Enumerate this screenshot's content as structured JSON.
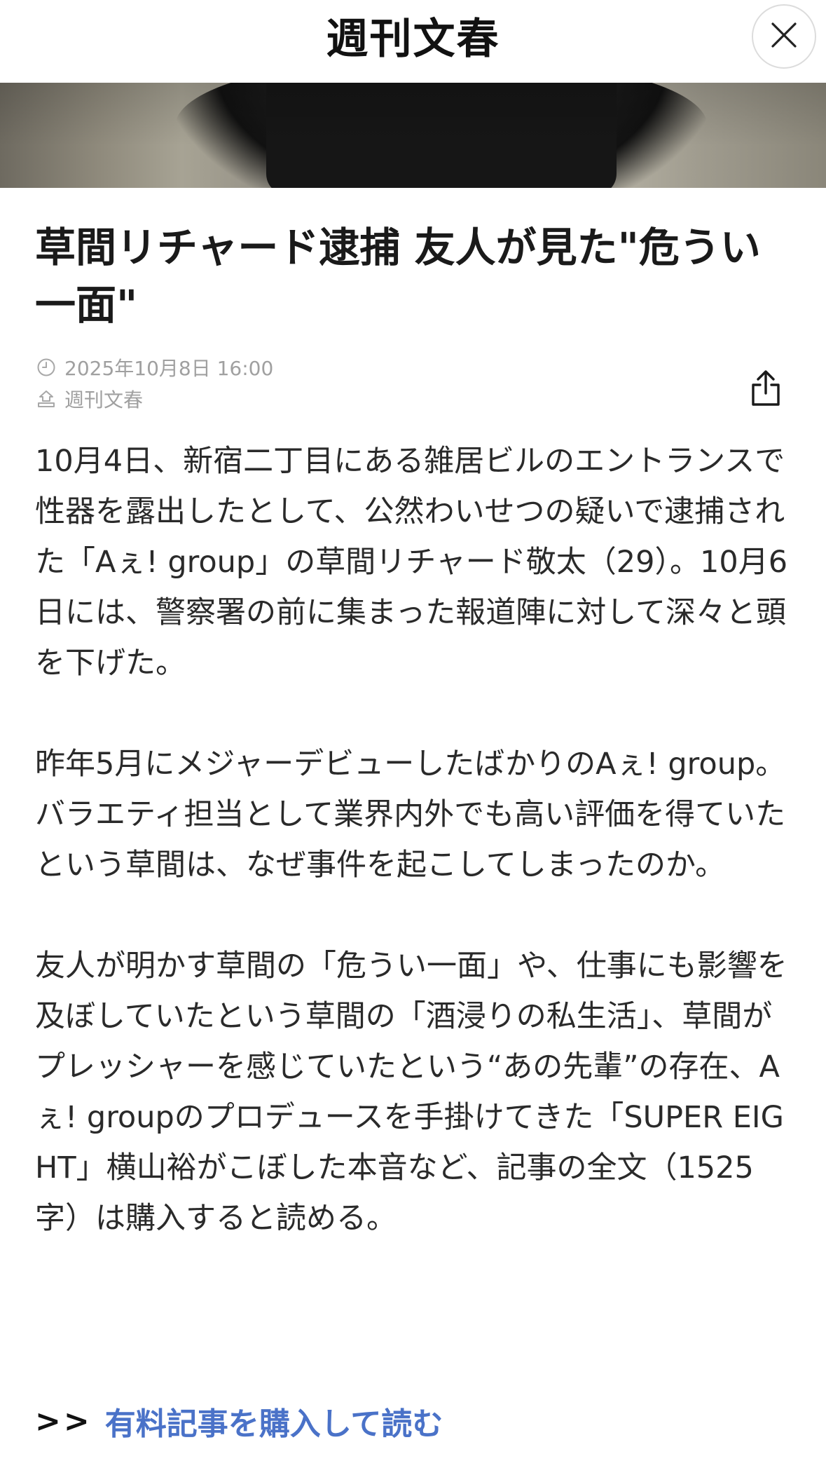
{
  "header": {
    "brand": "週刊文春",
    "close_icon": "close-icon"
  },
  "hero": {
    "description": "article-photo"
  },
  "article": {
    "title": "草間リチャード逮捕 友人が見た\"危うい一面\"",
    "date": "2025年10月8日 16:00",
    "source": "週刊文春",
    "date_icon": "clock-icon",
    "source_icon": "publisher-icon",
    "share_icon": "share-icon",
    "paragraphs": [
      "10月4日、新宿二丁目にある雑居ビルのエントランスで性器を露出したとして、公然わいせつの疑いで逮捕された「Aぇ! group」の草間リチャード敬太（29）。10月6日には、警察署の前に集まった報道陣に対して深々と頭を下げた。",
      "昨年5月にメジャーデビューしたばかりのAぇ! group。バラエティ担当として業界内外でも高い評価を得ていたという草間は、なぜ事件を起こしてしまったのか。",
      "友人が明かす草間の「危うい一面」や、仕事にも影響を及ぼしていたという草間の「酒浸りの私生活」、草間がプレッシャーを感じていたという“あの先輩”の存在、Aぇ! groupのプロデュースを手掛けてきた「SUPER EIGHT」横山裕がこぼした本音など、記事の全文（1525字）は購入すると読める。"
    ]
  },
  "cta": {
    "arrows": ">>",
    "link_label": "有料記事を購入して読む",
    "link_color": "#4a72c8"
  }
}
